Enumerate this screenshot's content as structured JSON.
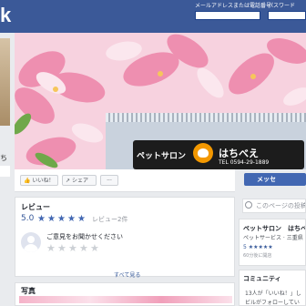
{
  "header": {
    "logo_tail": "k",
    "email_label": "メールアドレスまたは電話番号",
    "password_label": "パスワード"
  },
  "left": {
    "name_tail": "ち"
  },
  "cover": {
    "sign_left": "ペットサロン",
    "sign_name": "はちべえ",
    "sign_tel": "TEL 0594-29-1889"
  },
  "actions": {
    "like": "いいね！",
    "share": "シェア",
    "more": "···",
    "message": "メッセ"
  },
  "reviews": {
    "title": "レビュー",
    "rating": "5.0",
    "stars": 5,
    "count_text": "レビュー2件",
    "prompt": "ご意見をお聞かせください",
    "see_all": "すべて見る"
  },
  "photos": {
    "title": "写真"
  },
  "sidebar": {
    "search_placeholder": "このページの投稿を",
    "page_name": "ペットサロン　はちべ",
    "page_category": "ペットサービス · 三重県",
    "page_rating": "5 ★★★★★",
    "page_sub": "60分後に開店",
    "community_title": "コミュニティ",
    "community_line1": "13人が「いいね！」し",
    "community_line2": "ビルがフォローしてい"
  },
  "colors": {
    "brand": "#3b5998",
    "button": "#4267b2",
    "link": "#365899"
  }
}
